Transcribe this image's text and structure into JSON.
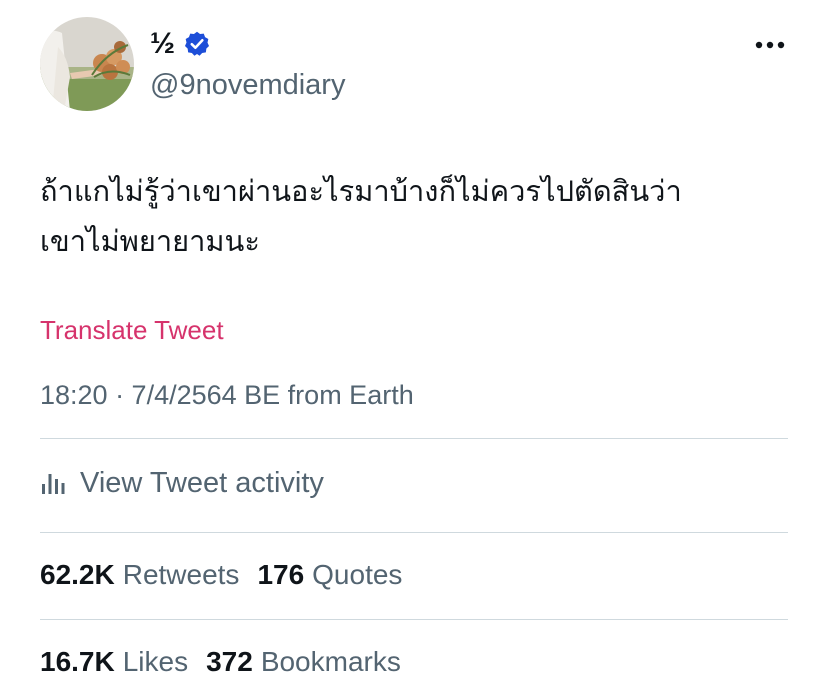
{
  "user": {
    "display_name": "½",
    "handle": "@9novemdiary",
    "avatar_icon": "profile-photo-flowers",
    "verified_icon": "verified-badge-icon",
    "verified_color": "#1d4ed8"
  },
  "menu": {
    "icon": "more-options-icon"
  },
  "tweet": {
    "text_line1": "ถ้าแกไม่รู้ว่าเขาผ่านอะไรมาบ้างก็ไม่ควรไปตัดสินว่า",
    "text_line2": "เขาไม่พยายามนะ",
    "translate_label": "Translate Tweet",
    "translate_color": "#d6336c",
    "meta": "18:20 · 7/4/2564 BE from Earth"
  },
  "activity": {
    "icon": "analytics-bar-icon",
    "label": "View Tweet activity"
  },
  "stats": {
    "retweets_count": "62.2K",
    "retweets_label": "Retweets",
    "quotes_count": "176",
    "quotes_label": "Quotes",
    "likes_count": "16.7K",
    "likes_label": "Likes",
    "bookmarks_count": "372",
    "bookmarks_label": "Bookmarks"
  }
}
